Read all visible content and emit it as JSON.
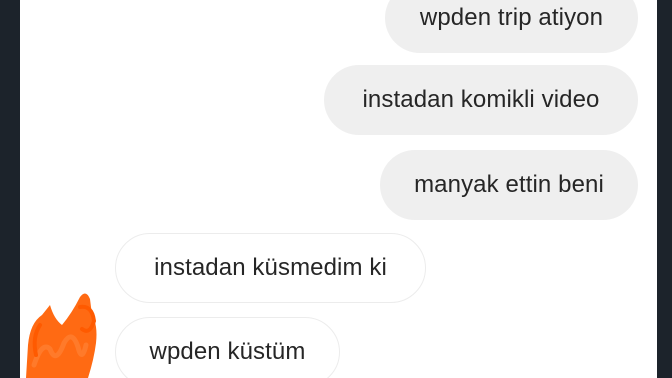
{
  "conversation": {
    "messages": [
      {
        "text": "wpden trip atiyon",
        "direction": "sent"
      },
      {
        "text": "instadan komikli video",
        "direction": "sent"
      },
      {
        "text": "manyak ettin beni",
        "direction": "sent"
      },
      {
        "text": "instadan küsmedim ki",
        "direction": "received"
      },
      {
        "text": "wpden küstüm",
        "direction": "received"
      }
    ]
  },
  "colors": {
    "sent_bubble": "#efefef",
    "received_border": "#ececec",
    "redaction_scribble": "#ff6a13",
    "frame_background": "#1c232b"
  }
}
